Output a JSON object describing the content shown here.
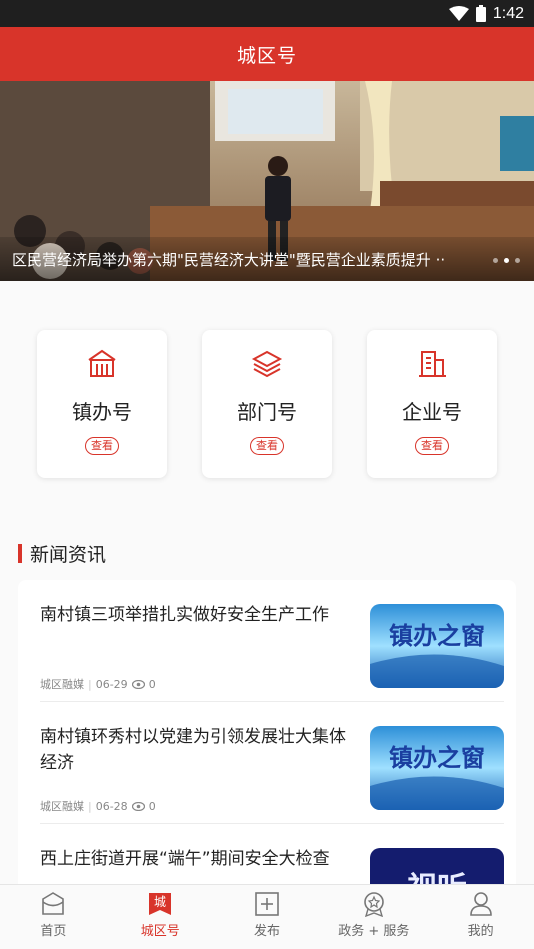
{
  "status_bar": {
    "time": "1:42"
  },
  "header": {
    "title": "城区号"
  },
  "banner": {
    "caption": "区民营经济局举办第六期\"民营经济大讲堂\"暨民营企业素质提升 ··"
  },
  "categories": [
    {
      "label": "镇办号",
      "action": "查看",
      "icon": "town-hall-icon"
    },
    {
      "label": "部门号",
      "action": "查看",
      "icon": "layers-icon"
    },
    {
      "label": "企业号",
      "action": "查看",
      "icon": "building-icon"
    }
  ],
  "news": {
    "section_title": "新闻资讯",
    "items": [
      {
        "headline": "南村镇三项举措扎实做好安全生产工作",
        "source": "城区融媒",
        "date": "06-29",
        "views": "0",
        "thumb_text": "镇办之窗"
      },
      {
        "headline": "南村镇环秀村以党建为引领发展壮大集体经济",
        "source": "城区融媒",
        "date": "06-28",
        "views": "0",
        "thumb_text": "镇办之窗"
      },
      {
        "headline": "西上庄街道开展“端午”期间安全大检查",
        "source": "",
        "date": "",
        "views": "",
        "thumb_text": "视听"
      }
    ]
  },
  "tabbar": {
    "tabs": [
      {
        "label": "首页",
        "icon": "home-icon"
      },
      {
        "label": "城区号",
        "icon": "city-badge-icon",
        "badge_char": "城"
      },
      {
        "label": "发布",
        "icon": "plus-box-icon"
      },
      {
        "label": "政务 + 服务",
        "icon": "service-medal-icon"
      },
      {
        "label": "我的",
        "icon": "user-icon"
      }
    ]
  },
  "colors": {
    "brand_red": "#d8342a"
  }
}
